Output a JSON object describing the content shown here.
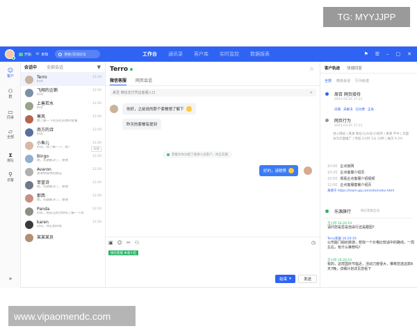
{
  "watermark_top": "TG: MYYJJPP",
  "watermark_bottom": "www.vipaomendc.com",
  "topbar": {
    "status_label": "开始",
    "status2_label": "未知",
    "search_placeholder": "搜索/添加好友",
    "tabs": [
      "工作台",
      "通讯录",
      "客户库",
      "实时监控",
      "数据报表"
    ],
    "active_tab": "工作台"
  },
  "nav": [
    {
      "label": "客户",
      "icon": "person-icon",
      "active": true
    },
    {
      "label": "群",
      "icon": "group-icon",
      "active": false
    },
    {
      "label": "同事",
      "icon": "colleague-icon",
      "active": false
    },
    {
      "label": "全部",
      "icon": "all-icon",
      "active": false
    },
    {
      "label": "排队",
      "icon": "queue-icon",
      "active": false
    },
    {
      "label": "访客",
      "icon": "visitor-icon",
      "active": false
    }
  ],
  "list": {
    "tabs": [
      "会话中",
      "全部会话"
    ],
    "rows": [
      {
        "name": "Terro",
        "preview": "好的",
        "time": "12:20",
        "color": "#c9b39a"
      },
      {
        "name": "飞翔的企鹅",
        "preview": "好的",
        "time": "12:20",
        "color": "#7a8fa8"
      },
      {
        "name": "上善若水",
        "preview": "好的",
        "time": "12:20",
        "color": "#9aa38a"
      },
      {
        "name": "寒风",
        "preview": "想了解一下有没有其他的套餐",
        "time": "12:20",
        "color": "#b5654c"
      },
      {
        "name": "南方的诗",
        "preview": "好的",
        "time": "12:20",
        "color": "#5a6fa0"
      },
      {
        "name": "小鱼儿",
        "preview": "好的，我了解一下，嗯?",
        "time": "12:20",
        "color": "#d8b8a0",
        "badge": "未接"
      },
      {
        "name": "Bingo",
        "preview": "嗯，问题解决了，谢谢",
        "time": "12:20",
        "color": "#8fb0d0"
      },
      {
        "name": "Avaron",
        "preview": "谢谢你提供的建议",
        "time": "12:20",
        "color": "#b0b0b0"
      },
      {
        "name": "菲蓝诗",
        "preview": "嗯，问题解决了，谢谢",
        "time": "12:20",
        "color": "#6e7a8a"
      },
      {
        "name": "那西",
        "preview": "嗯，问题解决了，谢谢",
        "time": "12:20",
        "color": "#c89080"
      },
      {
        "name": "Panda",
        "preview": "好好，目前已经为你的了解一下到",
        "time": "12:20",
        "color": "#8a9080"
      },
      {
        "name": "karen",
        "preview": "对的，你在如何呢",
        "time": "12:20",
        "color": "#3a3a3a"
      },
      {
        "name": "某某某员",
        "preview": "",
        "time": "",
        "color": "#b09070"
      }
    ]
  },
  "chat": {
    "title": "Terro",
    "tabs": [
      "微信客服",
      "网页会话"
    ],
    "notice": "来至 微信支付凭证客服入口",
    "messages": [
      {
        "text": "你好，之前说的那个套餐想了解下",
        "from": "customer"
      },
      {
        "text": "昨天的套餐有提到",
        "from": "customer"
      },
      {
        "text": "好的，请稍等",
        "from": "agent"
      }
    ],
    "system": "客服为你分配了来源人员客户，你正在跟",
    "tag": "微信客服 本意小区",
    "end_label": "结束",
    "send_label": "发送"
  },
  "side": {
    "tabs": [
      "客户轨迹",
      "快捷回复"
    ],
    "filters": [
      "全部",
      "微信会话",
      "行为轨迹"
    ],
    "card1": {
      "title": "周百 网页接待",
      "sub": "2021-03-25 17:21",
      "tags": [
        "日期",
        "未解决",
        "已付费",
        "正表"
      ]
    },
    "card2": {
      "title": "网页行为",
      "sub": "2021-03-25 17:21"
    },
    "path": "进入网站 | 来源 微信/公众号/小程序 | 来源 不中 | 页面 访问页面推广 | 停留 2小时 1分 10秒 | 展示 9.2%",
    "steps": [
      {
        "time": "10:00",
        "text": "企点官网"
      },
      {
        "time": "10:25",
        "text": "企点客服介绍页"
      },
      {
        "time": "10:50",
        "text": "观看企点客服介绍视频"
      },
      {
        "time": "12:00",
        "text": "企点客服套餐介绍页"
      }
    ],
    "link": "来源于 https://team.qq.com/site/index.html",
    "card3": {
      "title": "乐源旗行",
      "sub": "微信客服互动"
    },
    "history": [
      {
        "who": "王小印 16:20:10",
        "body": "请问您是否是自由行还是跟团?",
        "b": false
      },
      {
        "who": "Terry客服 16:20:10",
        "body": "公司能门组织旅游，想找一个价格比较适中的路线，一周左右，有什么推荐吗?",
        "b": true
      },
      {
        "who": "王小印 16:20:10",
        "body": "有的，这样国庆节临近，活动力度很大，推荐您选这款8天7晚，详细计划详见您看下",
        "b": false
      }
    ]
  }
}
